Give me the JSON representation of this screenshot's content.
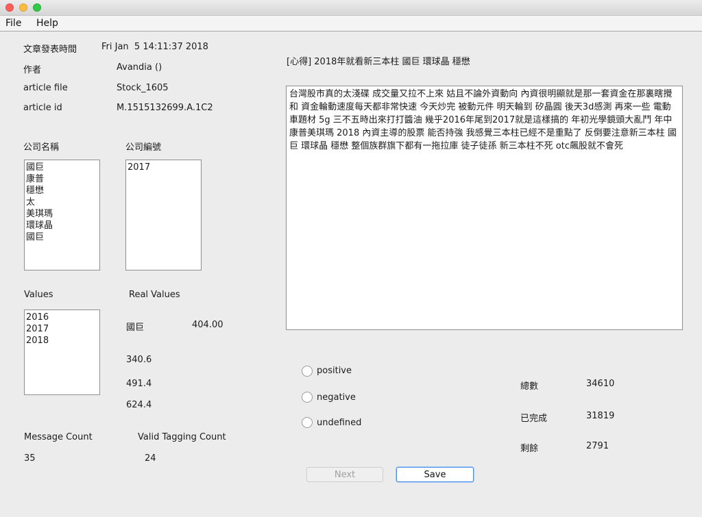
{
  "menu": {
    "file": "File",
    "help": "Help"
  },
  "meta": {
    "post_time_label": "文章發表時間",
    "post_time_value": "Fri Jan  5 14:11:37 2018",
    "author_label": "作者",
    "author_value": "Avandia ()",
    "article_file_label": "article file",
    "article_file_value": "Stock_1605",
    "article_id_label": "article id",
    "article_id_value": "M.1515132699.A.1C2"
  },
  "company_names": {
    "label": "公司名稱",
    "items": [
      "國巨",
      "康普",
      "穩懋",
      "太",
      "美琪瑪",
      "環球晶",
      "國巨"
    ]
  },
  "company_codes": {
    "label": "公司編號",
    "items": [
      "2017"
    ]
  },
  "values": {
    "label": "Values",
    "items": [
      "2016",
      "2017",
      "2018"
    ]
  },
  "real_values": {
    "label": "Real Values",
    "company": "國巨",
    "price": "404.00",
    "v1": "340.6",
    "v2": "491.4",
    "v3": "624.4"
  },
  "counts": {
    "message_count_label": "Message Count",
    "message_count_value": "35",
    "valid_tagging_label": "Valid Tagging Count",
    "valid_tagging_value": "24"
  },
  "article": {
    "title": "[心得] 2018年就看新三本柱 國巨 環球晶 穩懋",
    "body": "台灣股市真的太淺碟 成交量又拉不上來 姑且不論外資動向 內資很明顯就是那一套資金在那裏瞎攪和 資金輪動速度每天都非常快速 今天炒完 被動元件 明天輪到 矽晶圓 後天3d感測 再來一些 電動車題材 5g 三不五時出來打打醬油 幾乎2016年尾到2017就是這樣搞的 年初光學鏡頭大亂鬥 年中康普美琪瑪 2018 內資主導的股票 能否持強 我感覺三本柱已經不是重點了 反倒要注意新三本柱 國巨 環球晶 穩懋 整個族群旗下都有一拖拉庫 徒子徒孫 新三本柱不死 otc飆股就不會死"
  },
  "sentiment": {
    "positive": "positive",
    "negative": "negative",
    "undefined": "undefined"
  },
  "stats": {
    "total_label": "總數",
    "total_value": "34610",
    "done_label": "已完成",
    "done_value": "31819",
    "remaining_label": "剩餘",
    "remaining_value": "2791"
  },
  "buttons": {
    "next": "Next",
    "save": "Save"
  }
}
